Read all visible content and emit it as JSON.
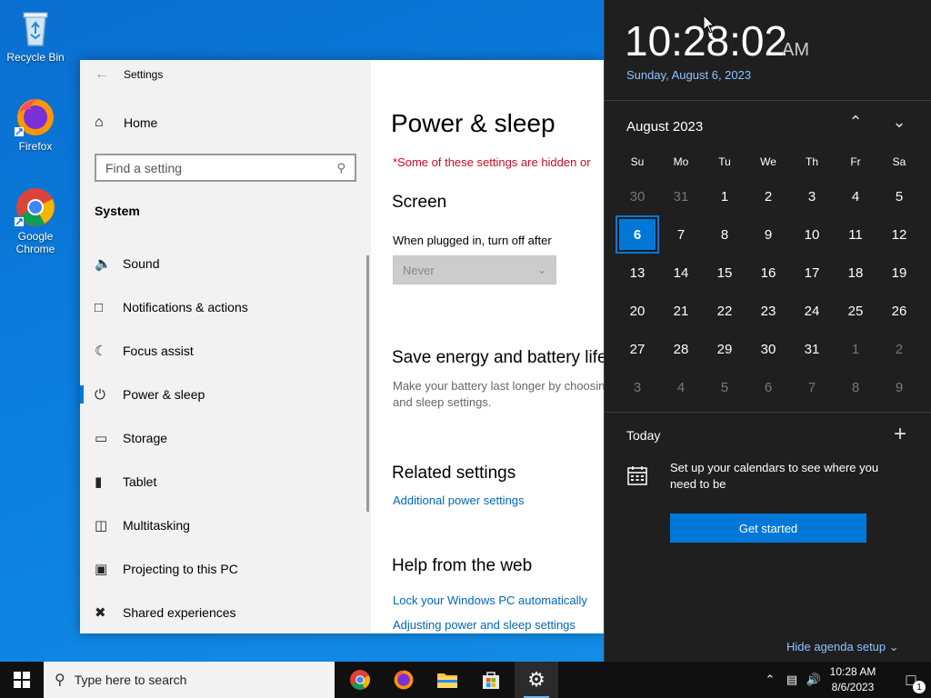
{
  "desktop": {
    "icons": [
      {
        "label": "Recycle Bin"
      },
      {
        "label": "Firefox"
      },
      {
        "label": "Google Chrome"
      }
    ]
  },
  "settings": {
    "title": "Settings",
    "home": "Home",
    "search_placeholder": "Find a setting",
    "section": "System",
    "nav": [
      {
        "label": "Sound",
        "icon": "speaker-icon"
      },
      {
        "label": "Notifications & actions",
        "icon": "message-icon"
      },
      {
        "label": "Focus assist",
        "icon": "moon-icon"
      },
      {
        "label": "Power & sleep",
        "icon": "power-icon",
        "active": true
      },
      {
        "label": "Storage",
        "icon": "storage-icon"
      },
      {
        "label": "Tablet",
        "icon": "tablet-icon"
      },
      {
        "label": "Multitasking",
        "icon": "multitasking-icon"
      },
      {
        "label": "Projecting to this PC",
        "icon": "projector-icon"
      },
      {
        "label": "Shared experiences",
        "icon": "share-icon"
      }
    ],
    "content": {
      "title": "Power & sleep",
      "warning": "*Some of these settings are hidden or",
      "screen_heading": "Screen",
      "plugged_label": "When plugged in, turn off after",
      "plugged_value": "Never",
      "save_heading": "Save energy and battery life",
      "save_desc_1": "Make your battery last longer by choosing",
      "save_desc_2": "and sleep settings.",
      "related_heading": "Related settings",
      "related_link": "Additional power settings",
      "help_heading": "Help from the web",
      "help_link_1": "Lock your Windows PC automatically",
      "help_link_2": "Adjusting power and sleep settings"
    }
  },
  "flyout": {
    "time": "10:28:02",
    "ampm": "AM",
    "date": "Sunday, August 6, 2023",
    "month": "August 2023",
    "weekdays": [
      "Su",
      "Mo",
      "Tu",
      "We",
      "Th",
      "Fr",
      "Sa"
    ],
    "days": [
      [
        "30",
        "dim"
      ],
      [
        "31",
        "dim"
      ],
      [
        "1",
        ""
      ],
      [
        "2",
        ""
      ],
      [
        "3",
        ""
      ],
      [
        "4",
        ""
      ],
      [
        "5",
        ""
      ],
      [
        "6",
        "today"
      ],
      [
        "7",
        ""
      ],
      [
        "8",
        ""
      ],
      [
        "9",
        ""
      ],
      [
        "10",
        ""
      ],
      [
        "11",
        ""
      ],
      [
        "12",
        ""
      ],
      [
        "13",
        ""
      ],
      [
        "14",
        ""
      ],
      [
        "15",
        ""
      ],
      [
        "16",
        ""
      ],
      [
        "17",
        ""
      ],
      [
        "18",
        ""
      ],
      [
        "19",
        ""
      ],
      [
        "20",
        ""
      ],
      [
        "21",
        ""
      ],
      [
        "22",
        ""
      ],
      [
        "23",
        ""
      ],
      [
        "24",
        ""
      ],
      [
        "25",
        ""
      ],
      [
        "26",
        ""
      ],
      [
        "27",
        ""
      ],
      [
        "28",
        ""
      ],
      [
        "29",
        ""
      ],
      [
        "30",
        ""
      ],
      [
        "31",
        ""
      ],
      [
        "1",
        "dim"
      ],
      [
        "2",
        "dim"
      ],
      [
        "3",
        "dim"
      ],
      [
        "4",
        "dim"
      ],
      [
        "5",
        "dim"
      ],
      [
        "6",
        "dim"
      ],
      [
        "7",
        "dim"
      ],
      [
        "8",
        "dim"
      ],
      [
        "9",
        "dim"
      ]
    ],
    "agenda_title": "Today",
    "agenda_message": "Set up your calendars to see where you need to be",
    "get_started": "Get started",
    "hide_agenda": "Hide agenda setup"
  },
  "taskbar": {
    "search_placeholder": "Type here to search",
    "clock_time": "10:28 AM",
    "clock_date": "8/6/2023",
    "notification_count": "1"
  },
  "colors": {
    "accent": "#0078d7",
    "link": "#0067b8",
    "warning": "#c50f1f",
    "flyout_bg": "#1f1f1f"
  }
}
